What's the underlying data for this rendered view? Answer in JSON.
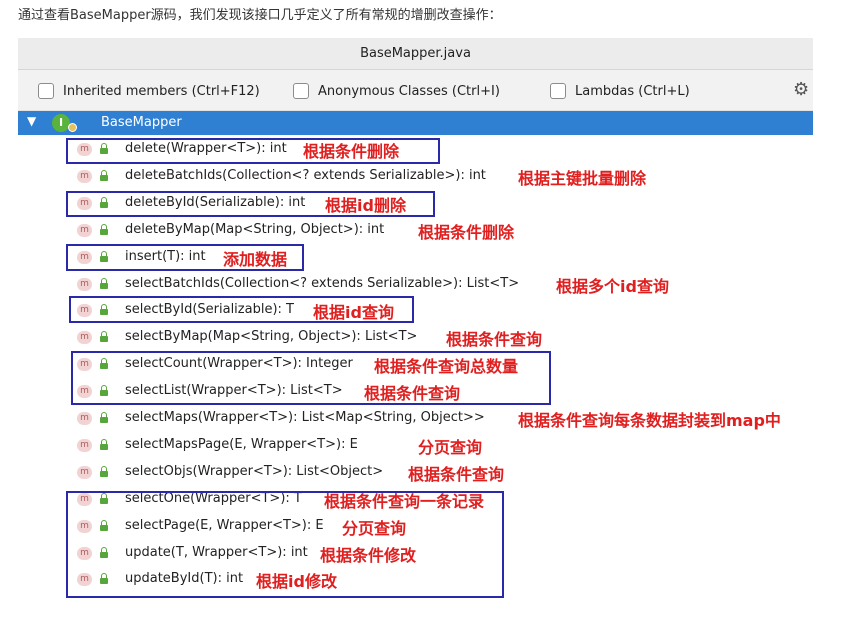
{
  "intro_text": "通过查看BaseMapper源码，我们发现该接口几乎定义了所有常规的增删改查操作：",
  "window": {
    "title": "BaseMapper.java"
  },
  "filters": [
    {
      "label": "Inherited members (Ctrl+F12)",
      "checked": false
    },
    {
      "label": "Anonymous Classes (Ctrl+I)",
      "checked": false
    },
    {
      "label": "Lambdas (Ctrl+L)",
      "checked": false
    }
  ],
  "settings_icon": "gear-icon",
  "tree": {
    "root": {
      "label": "BaseMapper",
      "icon": "interface-icon",
      "expanded": true
    },
    "method_icon_text": "m",
    "methods": [
      {
        "signature": "delete(Wrapper<T>): int",
        "note": "根据条件删除"
      },
      {
        "signature": "deleteBatchIds(Collection<? extends Serializable>): int",
        "note": "根据主键批量删除"
      },
      {
        "signature": "deleteById(Serializable): int",
        "note": "根据id删除"
      },
      {
        "signature": "deleteByMap(Map<String, Object>): int",
        "note": "根据条件删除"
      },
      {
        "signature": "insert(T): int",
        "note": "添加数据"
      },
      {
        "signature": "selectBatchIds(Collection<? extends Serializable>): List<T>",
        "note": "根据多个id查询"
      },
      {
        "signature": "selectById(Serializable): T",
        "note": "根据id查询"
      },
      {
        "signature": "selectByMap(Map<String, Object>): List<T>",
        "note": "根据条件查询"
      },
      {
        "signature": "selectCount(Wrapper<T>): Integer",
        "note": "根据条件查询总数量"
      },
      {
        "signature": "selectList(Wrapper<T>): List<T>",
        "note": "根据条件查询"
      },
      {
        "signature": "selectMaps(Wrapper<T>): List<Map<String, Object>>",
        "note": "根据条件查询每条数据封装到map中"
      },
      {
        "signature": "selectMapsPage(E, Wrapper<T>): E",
        "note": "分页查询"
      },
      {
        "signature": "selectObjs(Wrapper<T>): List<Object>",
        "note": "根据条件查询"
      },
      {
        "signature": "selectOne(Wrapper<T>): T",
        "note": "根据条件查询一条记录"
      },
      {
        "signature": "selectPage(E, Wrapper<T>): E",
        "note": "分页查询"
      },
      {
        "signature": "update(T, Wrapper<T>): int",
        "note": "根据条件修改"
      },
      {
        "signature": "updateById(T): int",
        "note": "根据id修改"
      }
    ]
  },
  "colors": {
    "selection": "#2f7fd3",
    "annotation": "#e02020",
    "highlight_box": "#2a2aa8"
  }
}
